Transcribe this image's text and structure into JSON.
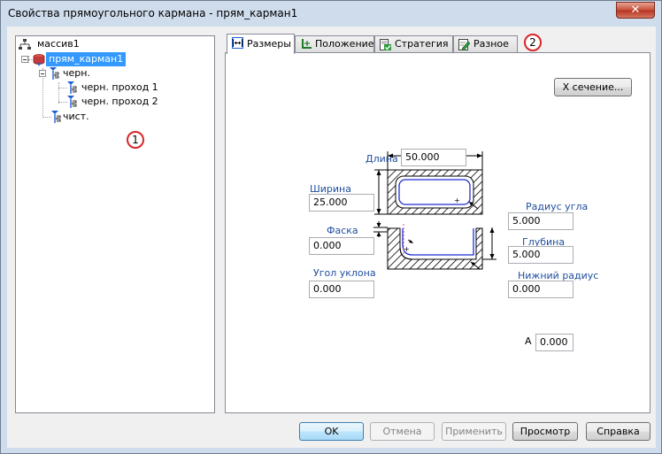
{
  "window": {
    "title": "Свойства прямоугольного кармана - прям_карман1",
    "close_glyph": "✕"
  },
  "tree": {
    "items": [
      {
        "label": "массив1"
      },
      {
        "label": "прям_карман1"
      },
      {
        "label": "черн."
      },
      {
        "label": "черн. проход 1"
      },
      {
        "label": "черн. проход 2"
      },
      {
        "label": "чист."
      }
    ]
  },
  "callouts": {
    "one": "1",
    "two": "2"
  },
  "tabs": [
    {
      "label": "Размеры",
      "icon": "dimension-arrows-icon"
    },
    {
      "label": "Положение",
      "icon": "axes-position-icon"
    },
    {
      "label": "Стратегия",
      "icon": "strategy-check-icon"
    },
    {
      "label": "Разное",
      "icon": "notepad-pencil-icon"
    }
  ],
  "dimensions": {
    "section_button": "X сечение...",
    "length_label": "Длина",
    "length_value": "50.000",
    "width_label": "Ширина",
    "width_value": "25.000",
    "corner_radius_label": "Радиус угла",
    "corner_radius_value": "5.000",
    "chamfer_label": "Фаска",
    "chamfer_value": "0.000",
    "depth_label": "Глубина",
    "depth_value": "5.000",
    "draft_angle_label": "Угол уклона",
    "draft_angle_value": "0.000",
    "bottom_radius_label": "Нижний радиус",
    "bottom_radius_value": "0.000",
    "a_label": "A",
    "a_value": "0.000"
  },
  "buttons": {
    "ok": "OK",
    "cancel": "Отмена",
    "apply": "Применить",
    "preview": "Просмотр",
    "help": "Справка"
  },
  "colors": {
    "selection": "#3399ff",
    "callout_ring": "#d7262a",
    "dim_label": "#1f4e9e",
    "close": "#c7503a"
  }
}
